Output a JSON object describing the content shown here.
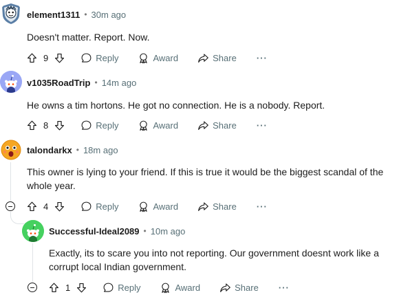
{
  "comments": [
    {
      "username": "element1311",
      "time": "30m ago",
      "text": "Doesn't matter. Report. Now.",
      "votes": "9",
      "reply": "Reply",
      "award": "Award",
      "share": "Share",
      "more": "···"
    },
    {
      "username": "v1035RoadTrip",
      "time": "14m ago",
      "text": "He owns a tim hortons. He got no connection. He is a nobody. Report.",
      "votes": "8",
      "reply": "Reply",
      "award": "Award",
      "share": "Share",
      "more": "···"
    },
    {
      "username": "talondarkx",
      "time": "18m ago",
      "text": "This owner is lying to your friend. If this is true it would be the biggest scandal of the whole year.",
      "votes": "4",
      "reply": "Reply",
      "award": "Award",
      "share": "Share",
      "more": "···"
    },
    {
      "username": "Successful-Ideal2089",
      "time": "10m ago",
      "text": "Exactly, its to scare you into not reporting. Our government doesnt work like a corrupt local Indian government.",
      "votes": "1",
      "reply": "Reply",
      "award": "Award",
      "share": "Share",
      "more": "···"
    }
  ],
  "separator": "•",
  "colors": {
    "meta_text": "#576f76",
    "thread_line": "#dfe3e6",
    "avatar_v1035": "#9aa7f5",
    "avatar_successful": "#46d160",
    "avatar_talondarkx": "#f5a623"
  }
}
